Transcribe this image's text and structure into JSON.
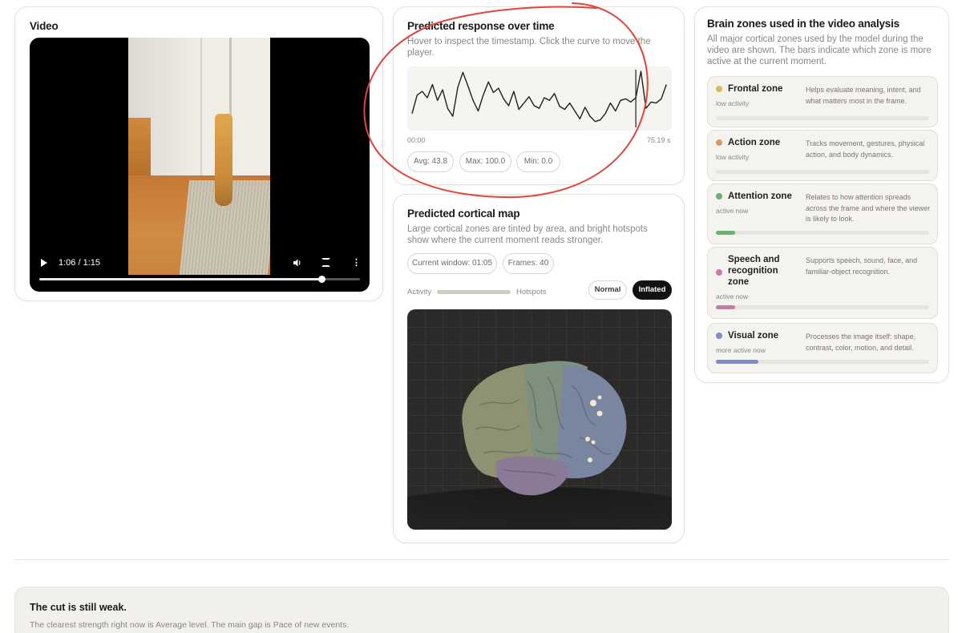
{
  "video": {
    "title": "Video",
    "time_display": "1:06 / 1:15",
    "progress": 0.88,
    "icons": [
      "play-icon",
      "volume-icon",
      "fullscreen-icon",
      "more-options-icon"
    ]
  },
  "response": {
    "title": "Predicted response over time",
    "hint": "Hover to inspect the timestamp. Click the curve to move the player.",
    "axis_start": "00:00",
    "axis_end": "75.19 s",
    "stats": {
      "avg": "Avg: 43.8",
      "max": "Max: 100.0",
      "min": "Min: 0.0"
    }
  },
  "chart_data": {
    "type": "line",
    "xlabel": "",
    "ylabel": "",
    "xlim": [
      0,
      75.19
    ],
    "ylim": [
      0,
      100
    ],
    "cursor_x": 66,
    "series": [
      {
        "x": [
          0,
          1.5,
          3,
          4.5,
          6,
          7.5,
          9,
          10.5,
          12,
          13.5,
          15,
          16.5,
          18,
          19.5,
          21,
          22.5,
          24,
          25.5,
          27,
          28.5,
          30,
          31.5,
          33,
          34.5,
          36,
          37.5,
          39,
          40.5,
          42,
          43.5,
          45,
          46.5,
          48,
          49.5,
          51,
          52.5,
          54,
          55.5,
          57,
          58.5,
          60,
          61.5,
          63,
          64.5,
          66,
          67.5,
          69,
          70.5,
          72,
          73.5,
          75
        ],
        "values": [
          20,
          55,
          62,
          50,
          75,
          45,
          65,
          30,
          15,
          70,
          98,
          72,
          45,
          25,
          55,
          80,
          60,
          68,
          48,
          35,
          62,
          28,
          40,
          52,
          35,
          30,
          50,
          45,
          58,
          34,
          28,
          40,
          25,
          10,
          32,
          15,
          5,
          8,
          20,
          40,
          25,
          45,
          48,
          42,
          50,
          100,
          30,
          42,
          40,
          48,
          75
        ]
      }
    ]
  },
  "cortical_map": {
    "title": "Predicted cortical map",
    "description": "Large cortical zones are tinted by area, and bright hotspots show where the current moment reads stronger.",
    "window_pill": "Current window: 01:05",
    "frames_pill": "Frames: 40",
    "activity_label": "Activity",
    "hotspots_label": "Hotspots",
    "mode_normal": "Normal",
    "mode_inflated": "Inflated",
    "active_mode": "Inflated"
  },
  "zones": {
    "title": "Brain zones used in the video analysis",
    "description": "All major cortical zones used by the model during the video are shown. The bars indicate which zone is more active at the current moment.",
    "items": [
      {
        "name": "Frontal zone",
        "status": "low activity",
        "description": "Helps evaluate meaning, intent, and what matters most in the frame.",
        "color": "#d8b85a",
        "level": 0
      },
      {
        "name": "Action zone",
        "status": "low activity",
        "description": "Tracks movement, gestures, physical action, and body dynamics.",
        "color": "#d79a62",
        "level": 0
      },
      {
        "name": "Attention zone",
        "status": "active now",
        "description": "Relates to how attention spreads across the frame and where the viewer is likely to look.",
        "color": "#6fae74",
        "level": 0.09
      },
      {
        "name": "Speech and recognition zone",
        "status": "active now",
        "description": "Supports speech, sound, face, and familiar-object recognition.",
        "color": "#c87ba5",
        "level": 0.09
      },
      {
        "name": "Visual zone",
        "status": "more active now",
        "description": "Processes the image itself: shape, contrast, color, motion, and detail.",
        "color": "#7b8cc4",
        "level": 0.2
      }
    ]
  },
  "summary": {
    "title": "The cut is still weak.",
    "body": "The clearest strength right now is Average level. The main gap is Pace of new events."
  },
  "colors": {
    "accent_dark": "#121212",
    "annotation_red": "#e0443c",
    "card_border": "#e4e2dd"
  }
}
